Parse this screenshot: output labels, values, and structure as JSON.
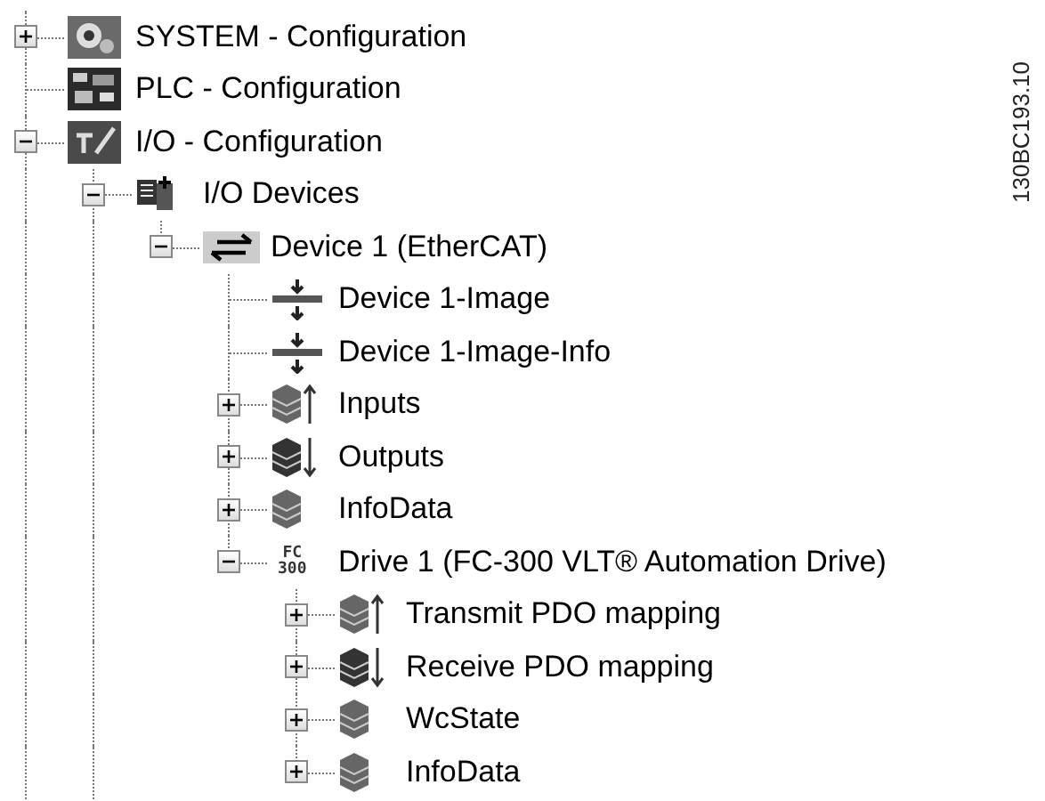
{
  "tree": [
    {
      "label": "SYSTEM - Configuration",
      "kind": "system",
      "expanded": false
    },
    {
      "label": "PLC - Configuration",
      "kind": "plc"
    },
    {
      "label": "I/O - Configuration",
      "kind": "io",
      "expanded": true,
      "children": [
        {
          "label": "I/O Devices",
          "kind": "devices",
          "expanded": true,
          "children": [
            {
              "label": "Device 1 (EtherCAT)",
              "kind": "ethercat",
              "expanded": true,
              "children": [
                {
                  "label": "Device 1-Image",
                  "kind": "image"
                },
                {
                  "label": "Device 1-Image-Info",
                  "kind": "image"
                },
                {
                  "label": "Inputs",
                  "kind": "inputs",
                  "expanded": false
                },
                {
                  "label": "Outputs",
                  "kind": "outputs",
                  "expanded": false
                },
                {
                  "label": "InfoData",
                  "kind": "infodata",
                  "expanded": false
                },
                {
                  "label": "Drive 1 (FC-300 VLT® Automation Drive)",
                  "kind": "drive",
                  "icon_lines": [
                    "FC",
                    "300"
                  ],
                  "expanded": true,
                  "children": [
                    {
                      "label": "Transmit PDO mapping",
                      "kind": "inputs",
                      "expanded": false
                    },
                    {
                      "label": "Receive PDO mapping",
                      "kind": "outputs",
                      "expanded": false
                    },
                    {
                      "label": "WcState",
                      "kind": "infodata",
                      "expanded": false
                    },
                    {
                      "label": "InfoData",
                      "kind": "infodata",
                      "expanded": false
                    }
                  ]
                }
              ]
            }
          ]
        }
      ]
    }
  ],
  "figure_code": "130BC193.10"
}
